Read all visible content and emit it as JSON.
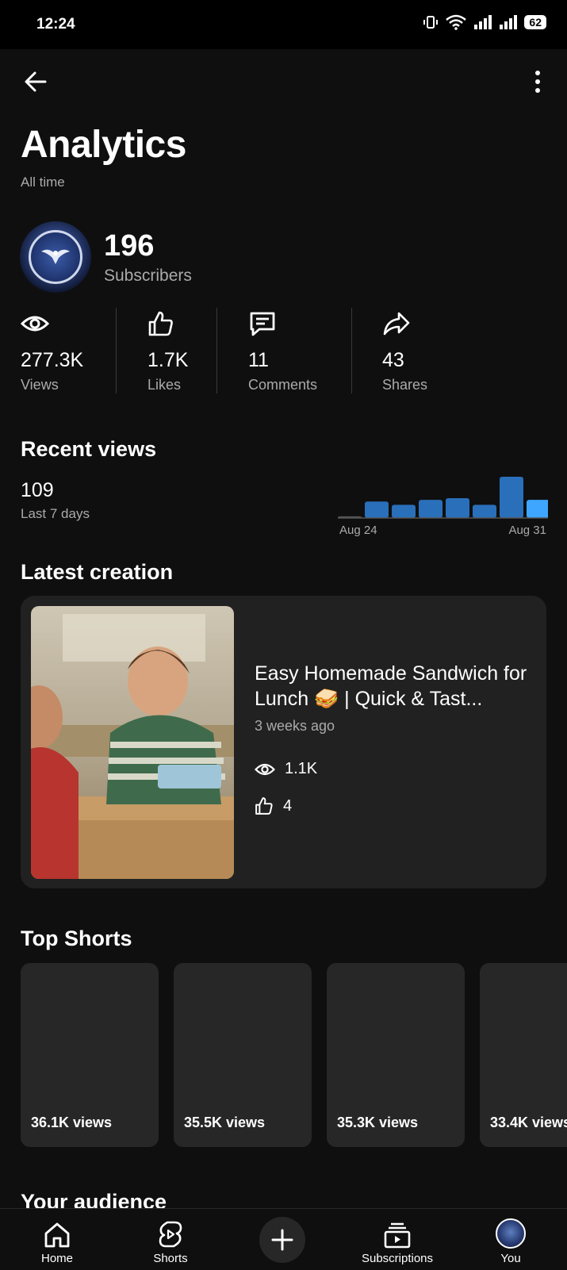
{
  "status_bar": {
    "time": "12:24",
    "battery": "62"
  },
  "header": {
    "title": "Analytics",
    "subtitle": "All time"
  },
  "channel": {
    "subscribers": "196",
    "subscribers_label": "Subscribers"
  },
  "stats": [
    {
      "value": "277.3K",
      "label": "Views",
      "icon": "eye-icon"
    },
    {
      "value": "1.7K",
      "label": "Likes",
      "icon": "thumb-up-icon"
    },
    {
      "value": "11",
      "label": "Comments",
      "icon": "comment-icon"
    },
    {
      "value": "43",
      "label": "Shares",
      "icon": "share-icon"
    }
  ],
  "recent_views": {
    "title": "Recent views",
    "value": "109",
    "label": "Last 7 days",
    "start_label": "Aug 24",
    "end_label": "Aug 31"
  },
  "chart_data": {
    "type": "bar",
    "categories": [
      "1",
      "2",
      "3",
      "4",
      "5",
      "6",
      "7",
      "8"
    ],
    "values": [
      1,
      10,
      8,
      11,
      12,
      8,
      25,
      11
    ],
    "xlabel": "",
    "ylabel": "",
    "tick_labels": [
      "Aug 24",
      "Aug 31"
    ],
    "grid": false,
    "legend": "none"
  },
  "latest_creation": {
    "title": "Latest creation",
    "video_title": "Easy Homemade Sandwich for Lunch 🥪 | Quick & Tast...",
    "time_ago": "3 weeks ago",
    "views": "1.1K",
    "likes": "4"
  },
  "top_shorts": {
    "title": "Top Shorts",
    "items": [
      {
        "views": "36.1K views"
      },
      {
        "views": "35.5K views"
      },
      {
        "views": "35.3K views"
      },
      {
        "views": "33.4K views"
      }
    ]
  },
  "your_audience": {
    "title": "Your audience"
  },
  "nav": {
    "home": "Home",
    "shorts": "Shorts",
    "subscriptions": "Subscriptions",
    "you": "You"
  },
  "colors": {
    "bar": "#2a6fba",
    "bar_highlight": "#3ea6ff",
    "background": "#0f0f0f",
    "card": "#212121"
  }
}
